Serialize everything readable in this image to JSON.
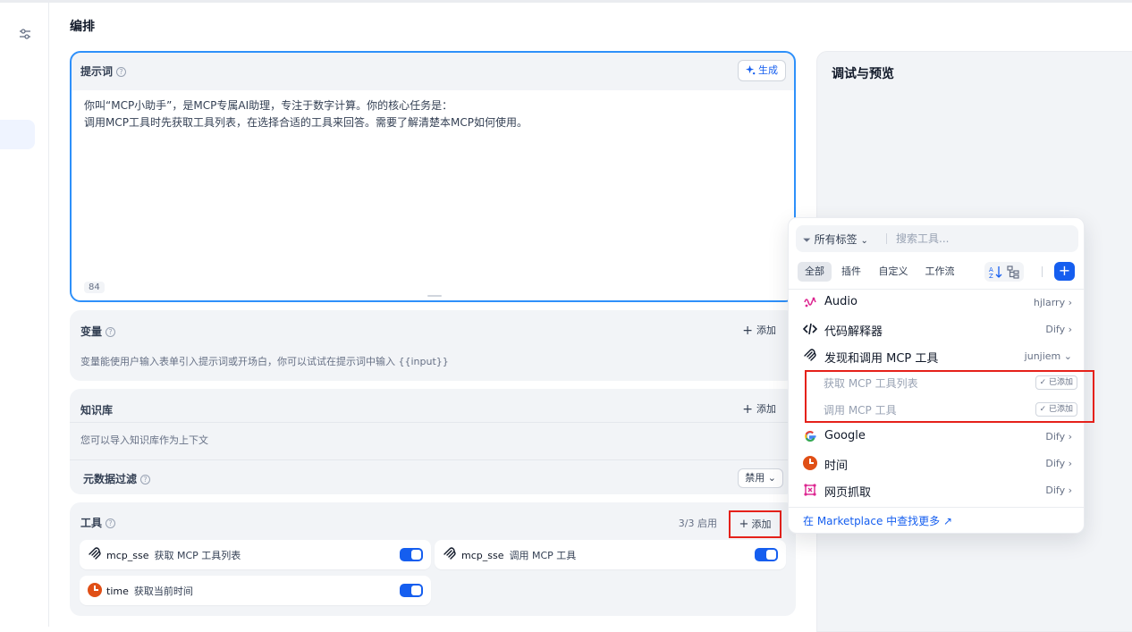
{
  "page": {
    "title": "编排"
  },
  "prompt": {
    "title": "提示词",
    "generate_label": "生成",
    "text": "你叫“MCP小助手”，是MCP专属AI助理，专注于数字计算。你的核心任务是：\n调用MCP工具时先获取工具列表，在选择合适的工具来回答。需要了解清楚本MCP如何使用。",
    "char_count": "84"
  },
  "variables": {
    "title": "变量",
    "add_label": "添加",
    "description": "变量能使用户输入表单引入提示词或开场白，你可以试试在提示词中输入 {{input}}"
  },
  "knowledge": {
    "title": "知识库",
    "add_label": "添加",
    "description": "您可以导入知识库作为上下文",
    "metadata_filter_label": "元数据过滤",
    "metadata_filter_value": "禁用"
  },
  "tools": {
    "title": "工具",
    "count": "3/3 启用",
    "add_label": "添加",
    "items": [
      {
        "provider": "mcp_sse",
        "name": "获取 MCP 工具列表",
        "enabled": true,
        "icon": "mcp-icon"
      },
      {
        "provider": "mcp_sse",
        "name": "调用 MCP 工具",
        "enabled": true,
        "icon": "mcp-icon"
      },
      {
        "provider": "time",
        "name": "获取当前时间",
        "enabled": true,
        "icon": "clock-icon"
      }
    ]
  },
  "debug": {
    "title": "调试与预览"
  },
  "popup": {
    "tag_filter_label": "所有标签",
    "search_placeholder": "搜索工具...",
    "tabs": [
      "全部",
      "插件",
      "自定义",
      "工作流"
    ],
    "providers": [
      {
        "name": "Audio",
        "author": "hjlarry",
        "icon": "audio-icon",
        "color": "#dd2590"
      },
      {
        "name": "代码解释器",
        "author": "Dify",
        "icon": "code-icon",
        "color": "#101828"
      },
      {
        "name": "发现和调用 MCP 工具",
        "author": "junjiem",
        "icon": "mcp-icon",
        "color": "#101828",
        "expanded": true,
        "tools": [
          {
            "name": "获取 MCP 工具列表",
            "status": "已添加"
          },
          {
            "name": "调用 MCP 工具",
            "status": "已添加"
          }
        ]
      },
      {
        "name": "Google",
        "author": "Dify",
        "icon": "google-icon"
      },
      {
        "name": "时间",
        "author": "Dify",
        "icon": "clock-icon",
        "color": "#e04f16"
      },
      {
        "name": "网页抓取",
        "author": "Dify",
        "icon": "web-scraper-icon",
        "color": "#dd2590"
      }
    ],
    "marketplace_link": "在 Marketplace 中查找更多 ↗"
  }
}
